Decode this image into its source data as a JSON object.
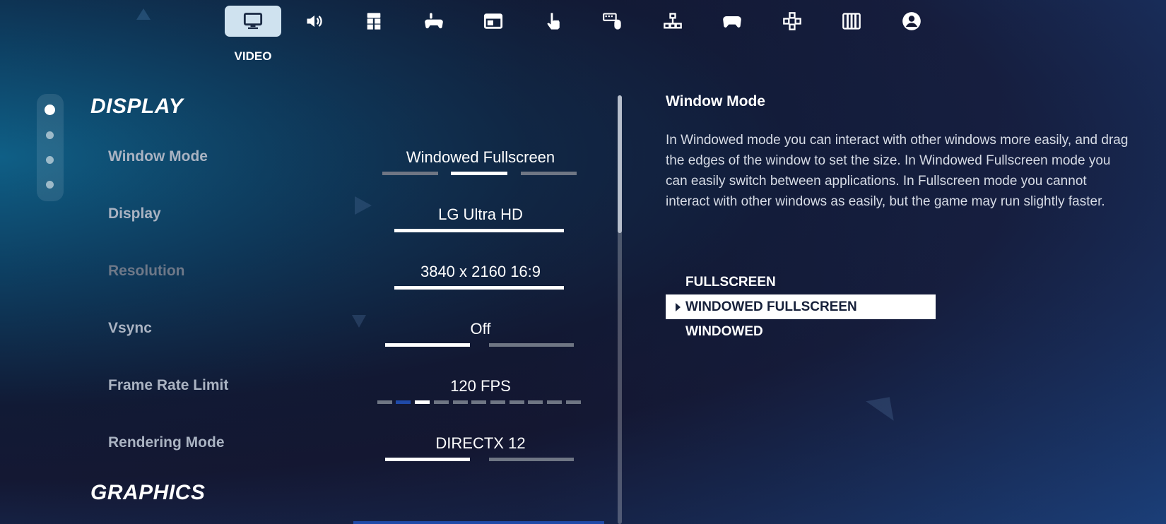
{
  "top_tabs": [
    {
      "icon": "monitor-icon",
      "active": true
    },
    {
      "icon": "speaker-icon"
    },
    {
      "icon": "gameplay-grid-icon"
    },
    {
      "icon": "controller-touch-icon"
    },
    {
      "icon": "window-icon"
    },
    {
      "icon": "touch-hand-icon"
    },
    {
      "icon": "keyboard-mouse-icon"
    },
    {
      "icon": "hierarchy-icon"
    },
    {
      "icon": "gamepad-icon"
    },
    {
      "icon": "dpad-icon"
    },
    {
      "icon": "piano-icon"
    },
    {
      "icon": "account-icon"
    }
  ],
  "active_tab_label": "VIDEO",
  "sections": {
    "display": "DISPLAY",
    "graphics": "GRAPHICS"
  },
  "settings": [
    {
      "label": "Window Mode",
      "value": "Windowed Fullscreen"
    },
    {
      "label": "Display",
      "value": "LG Ultra HD"
    },
    {
      "label": "Resolution",
      "value": "3840 x 2160 16:9"
    },
    {
      "label": "Vsync",
      "value": "Off"
    },
    {
      "label": "Frame Rate Limit",
      "value": "120 FPS"
    },
    {
      "label": "Rendering Mode",
      "value": "DIRECTX 12"
    }
  ],
  "description": {
    "title": "Window Mode",
    "body": "In Windowed mode you can interact with other windows more easily, and drag the edges of the window to set the size. In Windowed Fullscreen mode you can easily switch between applications. In Fullscreen mode you cannot interact with other windows as easily, but the game may run slightly faster."
  },
  "window_mode_options": [
    "FULLSCREEN",
    "WINDOWED FULLSCREEN",
    "WINDOWED"
  ],
  "selected_option": "WINDOWED FULLSCREEN",
  "colors": {
    "active_tab_bg": "#cfe2ef",
    "slider_on": "#ffffff",
    "slider_off": "#6f7684",
    "frame_rate_marker": "#1f4aa8"
  }
}
